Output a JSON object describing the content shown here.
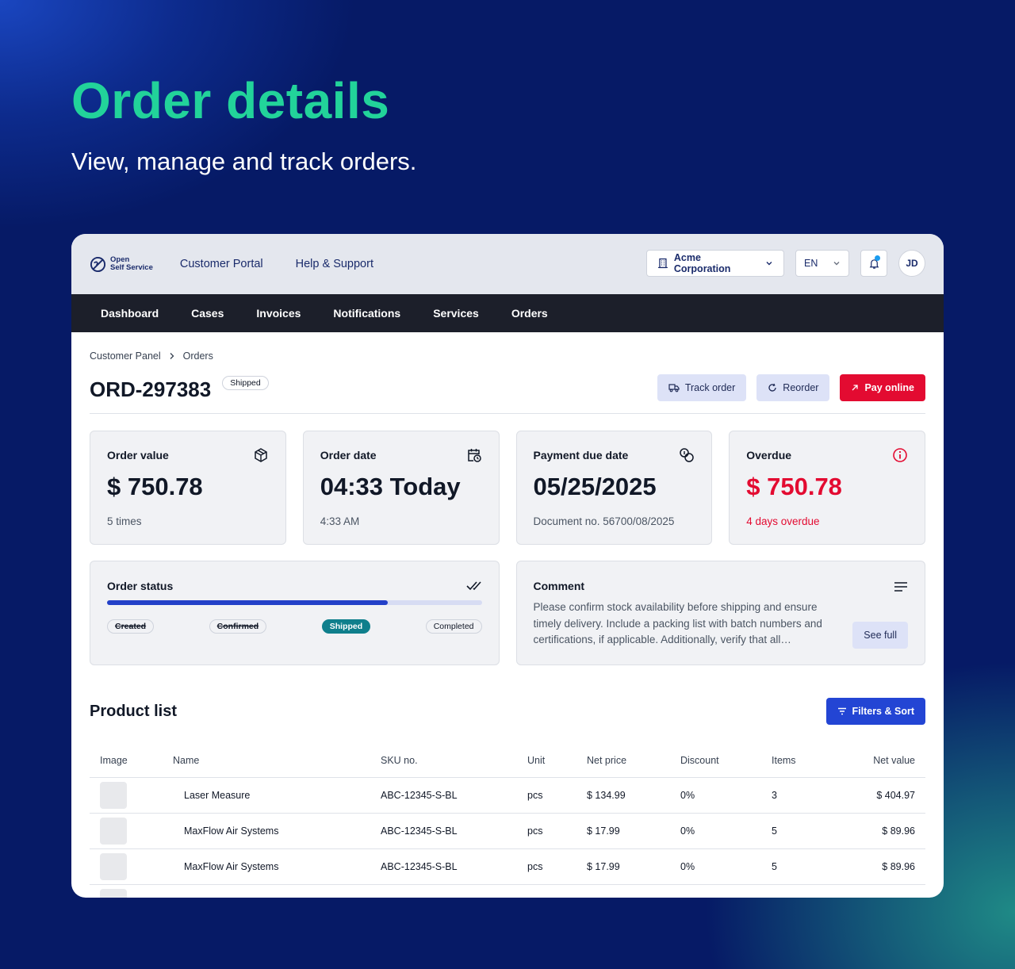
{
  "hero": {
    "title": "Order details",
    "subtitle": "View, manage and track orders."
  },
  "topbar": {
    "logo_line1": "Open",
    "logo_line2": "Self Service",
    "links": [
      "Customer Portal",
      "Help & Support"
    ],
    "organization": "Acme Corporation",
    "language": "EN",
    "avatar_initials": "JD"
  },
  "nav": [
    "Dashboard",
    "Cases",
    "Invoices",
    "Notifications",
    "Services",
    "Orders"
  ],
  "breadcrumb": [
    "Customer Panel",
    "Orders"
  ],
  "order": {
    "id": "ORD-297383",
    "status": "Shipped",
    "actions": {
      "track": "Track order",
      "reorder": "Reorder",
      "pay": "Pay online"
    }
  },
  "cards": [
    {
      "label": "Order value",
      "value": "$ 750.78",
      "sub": "5 times",
      "icon": "package-icon"
    },
    {
      "label": "Order date",
      "value": "04:33 Today",
      "sub": "4:33 AM",
      "icon": "calendar-clock-icon"
    },
    {
      "label": "Payment due date",
      "value": "05/25/2025",
      "sub": "Document no. 56700/08/2025",
      "icon": "coins-icon"
    },
    {
      "label": "Overdue",
      "value": "$ 750.78",
      "sub": "4 days overdue",
      "icon": "alert-circle-icon"
    }
  ],
  "order_status": {
    "label": "Order status",
    "progress": 0.75,
    "steps": [
      "Created",
      "Confirmed",
      "Shipped",
      "Completed"
    ]
  },
  "comment": {
    "label": "Comment",
    "text": "Please confirm stock availability before shipping and ensure timely delivery. Include a packing list with batch numbers and certifications, if applicable. Additionally, verify that all…",
    "see_full": "See full"
  },
  "product_list": {
    "title": "Product list",
    "filters_label": "Filters & Sort",
    "columns": [
      "Image",
      "Name",
      "SKU no.",
      "Unit",
      "Net price",
      "Discount",
      "Items",
      "Net value"
    ],
    "rows": [
      {
        "name": "Laser Measure",
        "sku": "ABC-12345-S-BL",
        "unit": "pcs",
        "net_price": "$ 134.99",
        "discount": "0%",
        "items": "3",
        "net_value": "$ 404.97"
      },
      {
        "name": "MaxFlow Air Systems",
        "sku": "ABC-12345-S-BL",
        "unit": "pcs",
        "net_price": "$ 17.99",
        "discount": "0%",
        "items": "5",
        "net_value": "$ 89.96"
      },
      {
        "name": "MaxFlow Air Systems",
        "sku": "ABC-12345-S-BL",
        "unit": "pcs",
        "net_price": "$ 17.99",
        "discount": "0%",
        "items": "5",
        "net_value": "$ 89.96"
      }
    ]
  },
  "colors": {
    "accent_green": "#22d39a",
    "primary_blue": "#2345d4",
    "danger_red": "#e30b31",
    "status_teal": "#0f7f8c"
  }
}
